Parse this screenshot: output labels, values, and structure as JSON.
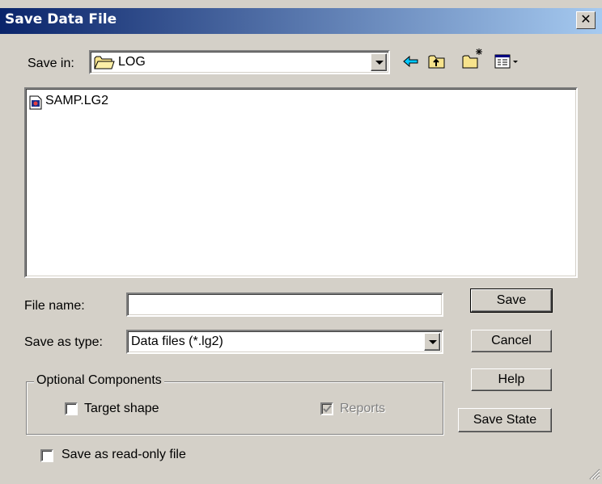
{
  "window": {
    "title": "Save Data File",
    "close_label": "✕"
  },
  "toolbar": {
    "save_in_label": "Save in:",
    "location": "LOG",
    "back_icon": "back-arrow-icon",
    "up_icon": "up-folder-icon",
    "new_folder_icon": "new-folder-icon",
    "view_menu_icon": "view-menu-icon"
  },
  "files": [
    {
      "name": "SAMP.LG2",
      "icon": "lg2-file-icon"
    }
  ],
  "form": {
    "file_name_label": "File name:",
    "file_name_value": "",
    "save_as_type_label": "Save as type:",
    "save_as_type_value": "Data files (*.lg2)",
    "optional_components_label": "Optional Components",
    "target_shape_label": "Target shape",
    "reports_label": "Reports",
    "read_only_label": "Save as read-only file"
  },
  "buttons": {
    "save": "Save",
    "cancel": "Cancel",
    "help": "Help",
    "save_state": "Save State"
  },
  "colors": {
    "title_start": "#0a246a",
    "title_end": "#a6caf0",
    "face": "#d4d0c8"
  }
}
